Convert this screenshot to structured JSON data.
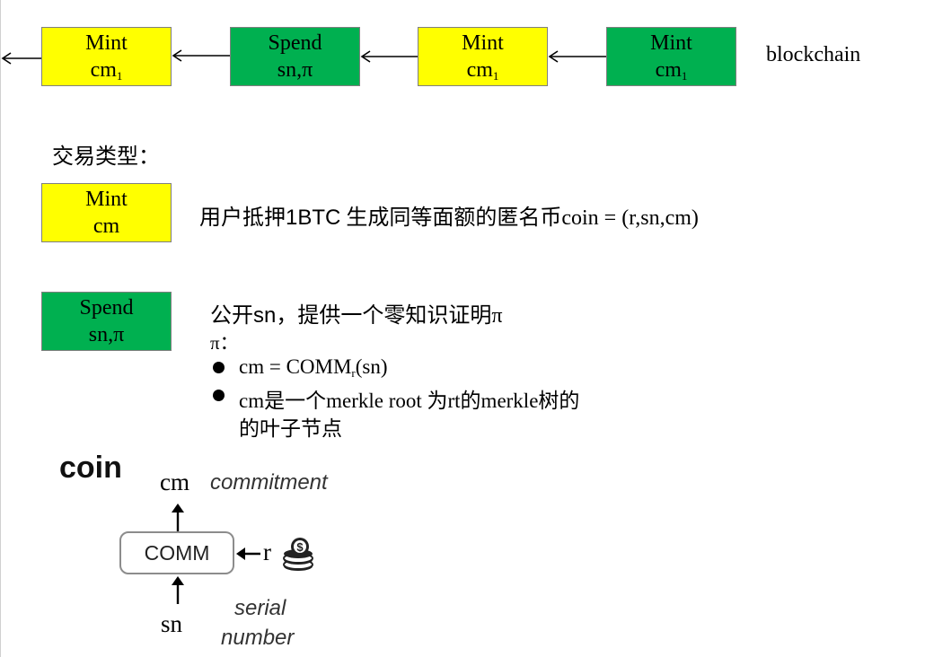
{
  "chain": {
    "blocks": [
      {
        "type": "mint",
        "line1": "Mint",
        "line2": "cm",
        "sub": "1"
      },
      {
        "type": "spend",
        "line1": "Spend",
        "line2": "sn,π",
        "sub": ""
      },
      {
        "type": "mint",
        "line1": "Mint",
        "line2": "cm",
        "sub": "1"
      },
      {
        "type": "mint-green",
        "line1": "Mint",
        "line2": "cm",
        "sub": "1"
      }
    ],
    "label": "blockchain"
  },
  "types": {
    "heading": "交易类型：",
    "mint": {
      "line1": "Mint",
      "line2": "cm",
      "desc_cn": "用户抵押",
      "desc_amount": "1BTC",
      "desc_rest": " 生成同等面额的匿名币",
      "desc_formula": "coin = (r,sn,cm)"
    },
    "spend": {
      "line1": "Spend",
      "line2": "sn,π",
      "line_a_pre": "公开",
      "line_a_sn": "sn",
      "line_a_post": "，提供一个零知识证明π",
      "pi_label": "π：",
      "bullet1_pre": "cm = COMM",
      "bullet1_sub": "r",
      "bullet1_post": "(sn)",
      "bullet2_line1": "cm是一个merkle root 为rt的merkle树的",
      "bullet2_line2": "的叶子节点"
    }
  },
  "coin_diagram": {
    "title": "coin",
    "comm_label": "COMM",
    "cm_label": "cm",
    "cm_desc": "commitment",
    "r_label": "r",
    "sn_label": "sn",
    "sn_desc_line1": "serial",
    "sn_desc_line2": "number",
    "icon": "coin-stack-icon"
  },
  "colors": {
    "mint": "#ffff00",
    "spend": "#00b050",
    "border": "#7f7f7f"
  }
}
